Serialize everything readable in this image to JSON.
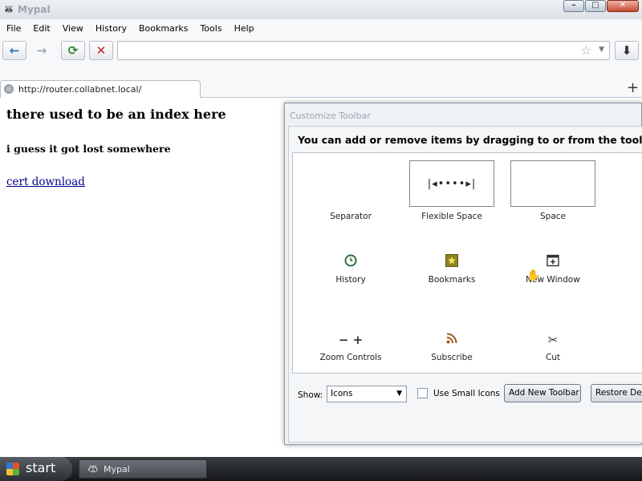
{
  "window": {
    "title": "Mypal",
    "icon": "raccoon-app-icon",
    "controls": {
      "minimize": "–",
      "maximize": "□",
      "close": "✕"
    }
  },
  "menubar": {
    "items": [
      {
        "label": "File"
      },
      {
        "label": "Edit"
      },
      {
        "label": "View"
      },
      {
        "label": "History"
      },
      {
        "label": "Bookmarks"
      },
      {
        "label": "Tools"
      },
      {
        "label": "Help"
      }
    ]
  },
  "navbar": {
    "back_icon": "←",
    "forward_icon": "→",
    "reload_icon": "⟳",
    "stop_icon": "✕",
    "download_icon": "⬇",
    "url_value": "",
    "star_icon": "☆"
  },
  "tabs": [
    {
      "label": "http://router.collabnet.local/",
      "active": true
    }
  ],
  "page": {
    "heading": "there used to be an index here",
    "subheading": "i guess it got lost somewhere",
    "link": "cert download"
  },
  "dialog": {
    "title": "Customize Toolbar",
    "heading": "You can add or remove items by dragging to or from the toolbar",
    "palette": [
      {
        "label": "Separator",
        "icon": "separator-icon",
        "glyph": ""
      },
      {
        "label": "Flexible Space",
        "icon": "flexible-space-icon",
        "glyph": "|◂••••▸|"
      },
      {
        "label": "Space",
        "icon": "space-icon",
        "glyph": ""
      },
      {
        "label": "History",
        "icon": "history-clock-icon",
        "glyph": "🕑"
      },
      {
        "label": "Bookmarks",
        "icon": "bookmarks-star-icon",
        "glyph": "★"
      },
      {
        "label": "New Window",
        "icon": "new-window-icon",
        "glyph": "⊞"
      },
      {
        "label": "Zoom Controls",
        "icon": "zoom-controls-icon",
        "glyph": "−  +"
      },
      {
        "label": "Subscribe",
        "icon": "rss-subscribe-icon",
        "glyph": "◠"
      },
      {
        "label": "Cut",
        "icon": "scissors-cut-icon",
        "glyph": "✂"
      }
    ],
    "show_label": "Show:",
    "show_value": "Icons",
    "small_icons_label": "Use Small Icons",
    "small_icons_checked": false,
    "add_toolbar_label": "Add New Toolbar",
    "restore_label": "Restore Default Set"
  },
  "taskbar": {
    "start_label": "start",
    "task_label": "Mypal"
  }
}
